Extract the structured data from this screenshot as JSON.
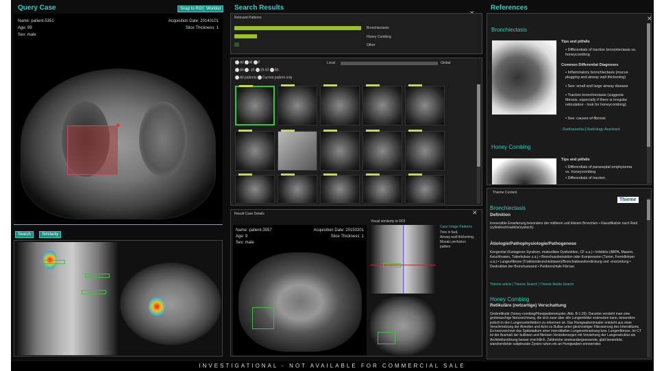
{
  "query": {
    "title": "Query Case",
    "snap_btn": "Snap to ROI",
    "worklist_btn": "Worklist",
    "name": "Name: patient-5351",
    "age": "Age: 99",
    "sex": "Sex: male",
    "acq": "Acquisition Date: 20140101",
    "slice": "Slice Thickness: 1",
    "search_btn": "Search",
    "similarity_btn": "Similarity"
  },
  "search": {
    "title": "Search Results",
    "relevant": "Relevant Patterns",
    "patterns": [
      {
        "label": "Bronchiectasis",
        "pct": 1.0
      },
      {
        "label": "Honey Combing",
        "pct": 0.18
      },
      {
        "label": "Other",
        "pct": 0.04
      }
    ],
    "filters": {
      "all": "All",
      "m": "M",
      "f": "F",
      "all2": "All",
      "age1": "-18",
      "age2": "18-50",
      "age3": "50-",
      "all_patients": "All patients",
      "current": "Current patient only",
      "local": "Local",
      "global": "Global"
    }
  },
  "detail": {
    "title": "Result Case Details",
    "name": "Name: patient-3557",
    "age": "Age: 9",
    "sex": "Sex: male",
    "acq": "Acquisition Date: 20150201",
    "slice": "Slice Thickness: 1",
    "visual": "Visual similarity to ROI",
    "patterns_title": "Case Image Patterns",
    "patterns_text": [
      "Tree in bud,",
      "Airway wall thickening,",
      "Mosaic perfusion",
      "pattern"
    ]
  },
  "refs": {
    "title": "References",
    "s1_title": "Bronchiectasis",
    "tips": "Tips and pitfalls",
    "s1_bullet1": "Differentials of traction bronchiectasis vs. honeycombing",
    "cdd": "Common Differential Diagnoses",
    "cdd_items": [
      "Inflammatory bronchiectasis (mucus plugging and airway wall thickening)",
      "See: small and large airway disease",
      "Traction bronchiectasis (suggests fibrosis, especially if there is irregular reticulation - look for honeycombing)",
      "See: causes of fibrosis"
    ],
    "link1": "Radiopaedia",
    "sep": "|",
    "link2": "Radiology Assistant",
    "s2_title": "Honey Combing",
    "tips2": "Tips and pitfalls",
    "s2_items": [
      "Differentials of paraseptal emphysema vs. honeycombing",
      "Differentials of traction"
    ]
  },
  "thieme": {
    "header": "Thieme Content",
    "logo": "Thieme",
    "t1": "Bronchiectasis",
    "def": "Definition",
    "def_text": "Irreversible Erweiterung besonders der mittleren und kleinen Bronchien • Klassifikation nach Reid (zylindrisch/varikös/zystisch).",
    "aet": "Ätiologie/Pathophysiologie/Pathogenese",
    "aet_text": "Kongenital (Kartagener-Syndrom, mukoziliäre Dysfunktion, CF u.a.) • Infektiös (ABPA, Masern, Keuchhusten, Tuberkulose u.a.) • Bronchusobstruktion oder Kompression (Tumor, Fremdkörper u.a.) • Lungenfibrose (Traktionsbronchiektasen)/Bronchialwandverdickung und -entzündung • Destruktion der Bronchuswand • Peribronchiale Fibrose.",
    "links": "Thieme article  |  Thieme Search  |  Thieme Media Search",
    "t2": "Honey Combing",
    "t2sub": "Retikuläre (netzartige) Verschattung",
    "t2_text": "Grobretikulär (honey-combing/Honigwabenmuster, Abb. B-1.26): Darunter versteht man eine grobmaschige Netzzeichnung, die sich zwar über alle Lungenfelder erstrecken kann, besonders jedoch in den Lungenunterfeldern zu erkennen ist. Das Honigwabenmuster entsteht aus einer Verschmelzung der Alveolen und Azini zu Bullae unter gleichzeitiger Fibrosierung des Interstitiums. Es kennzeichnet das Spätstadium einer interstitiellen Lungenerkrankung bzw. Lungenfibrose. Im CT ist der Ausmaß der bullösen und fibrösen Veränderungen mit Verziehung der Lungenstruktur als Architekturstörung besser ersichtlich. Zahlreiche aneinandergrenzende, glatt berandete, wandverdickte subpleurale Zysten ruhen ein an Honigwaben erinnerndes"
  },
  "footer": "INVESTIGATIONAL - NOT AVAILABLE FOR COMMERCIAL SALE"
}
